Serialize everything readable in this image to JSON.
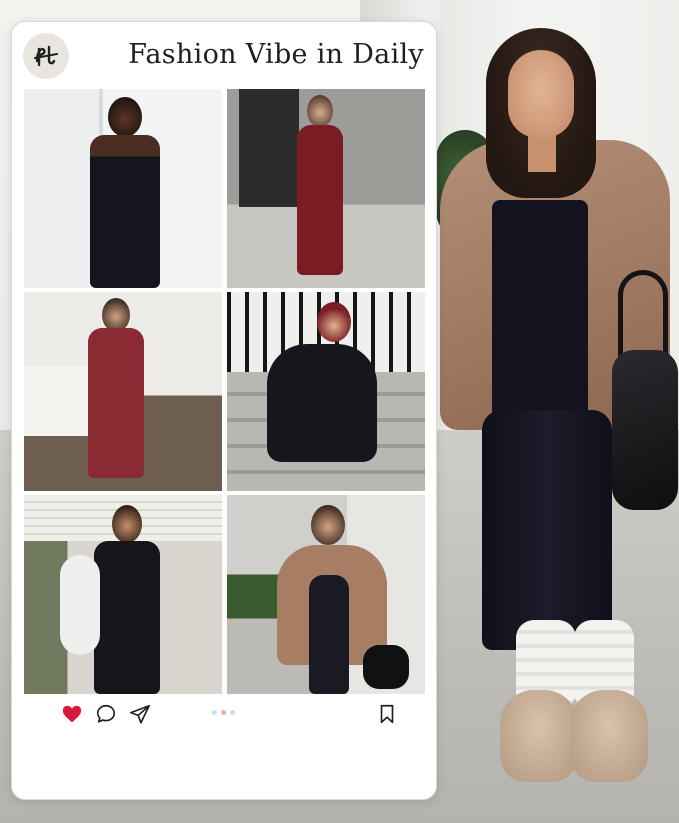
{
  "post": {
    "title": "Fashion Vibe in Daily",
    "avatar_icon": "monogram-logo",
    "photos": [
      {
        "id": "photo-1",
        "outfit_color": "#15151d",
        "background": "white-door-interior"
      },
      {
        "id": "photo-2",
        "outfit_color": "#7a1c24",
        "background": "concrete-doorway"
      },
      {
        "id": "photo-3",
        "outfit_color": "#8a2b33",
        "background": "living-room"
      },
      {
        "id": "photo-4",
        "outfit_color": "#16161c",
        "background": "stone-steps"
      },
      {
        "id": "photo-5",
        "outfit_color": "#15151b",
        "background": "porch-interior"
      },
      {
        "id": "photo-6",
        "outfit_color": "#1a1a22",
        "background": "garden-sidewalk"
      }
    ],
    "actions": {
      "like_icon": "heart-icon",
      "like_color": "#d9193a",
      "comment_icon": "comment-icon",
      "share_icon": "send-icon",
      "save_icon": "bookmark-icon"
    },
    "carousel": {
      "total": 3,
      "active_index": 1
    }
  },
  "colors": {
    "card_bg": "#ffffff",
    "accent_dot": "#e8b08d"
  }
}
